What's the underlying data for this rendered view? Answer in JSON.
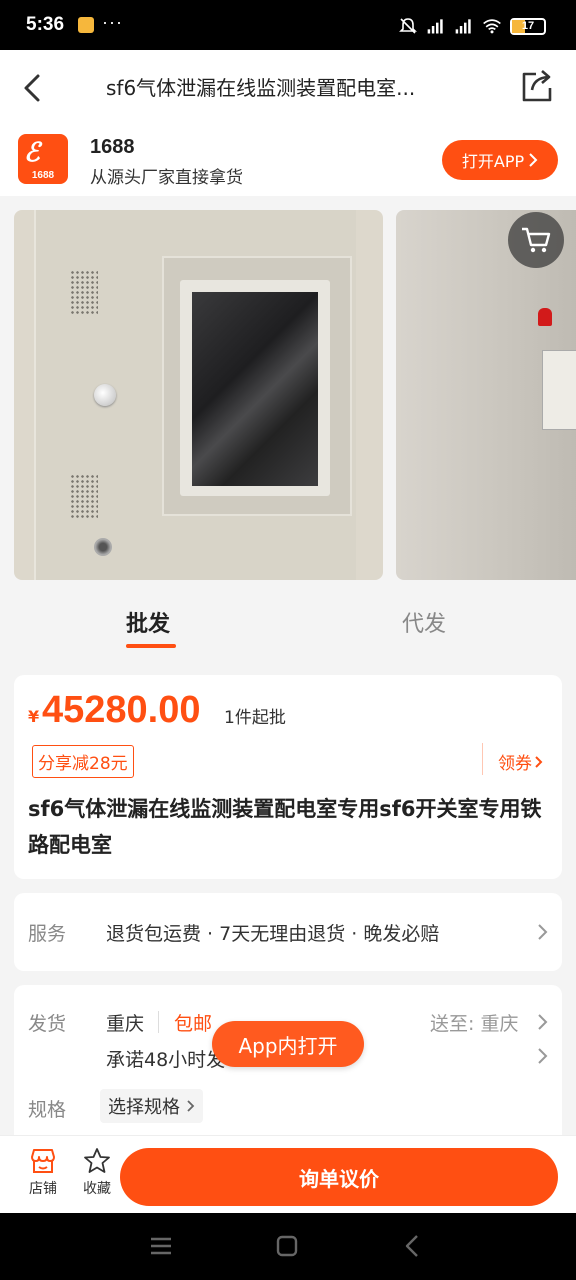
{
  "status_bar": {
    "time": "5:36",
    "dots": "···",
    "battery": "17"
  },
  "header": {
    "title": "sf6气体泄漏在线监测装置配电室...",
    "back_icon": "back-arrow-icon",
    "share_icon": "share-icon"
  },
  "app_banner": {
    "logo_text": "1688",
    "name": "1688",
    "slogan": "从源头厂家直接拿货",
    "open_app_label": "打开APP"
  },
  "gallery": {
    "cart_icon": "cart-icon"
  },
  "tabs": [
    {
      "label": "批发",
      "active": true
    },
    {
      "label": "代发",
      "active": false
    }
  ],
  "price_card": {
    "currency": "¥",
    "price": "45280.00",
    "moq": "1件起批",
    "coupon_tag": "分享减28元",
    "get_coupon": "领券",
    "product_title": "sf6气体泄漏在线监测装置配电室专用sf6开关室专用铁路配电室"
  },
  "service": {
    "label": "服务",
    "text": "退货包运费 · 7天无理由退货 · 晚发必赔"
  },
  "shipping": {
    "label": "发货",
    "from": "重庆",
    "free_shipping": "包邮",
    "deliver_to": "送至: 重庆",
    "promise": "承诺48小时发",
    "spec_label": "规格",
    "spec_button": "选择规格"
  },
  "floating_button": "App内打开",
  "bottom_bar": {
    "store": "店铺",
    "favorite": "收藏",
    "inquiry": "询单议价"
  },
  "colors": {
    "accent": "#ff4f12"
  }
}
